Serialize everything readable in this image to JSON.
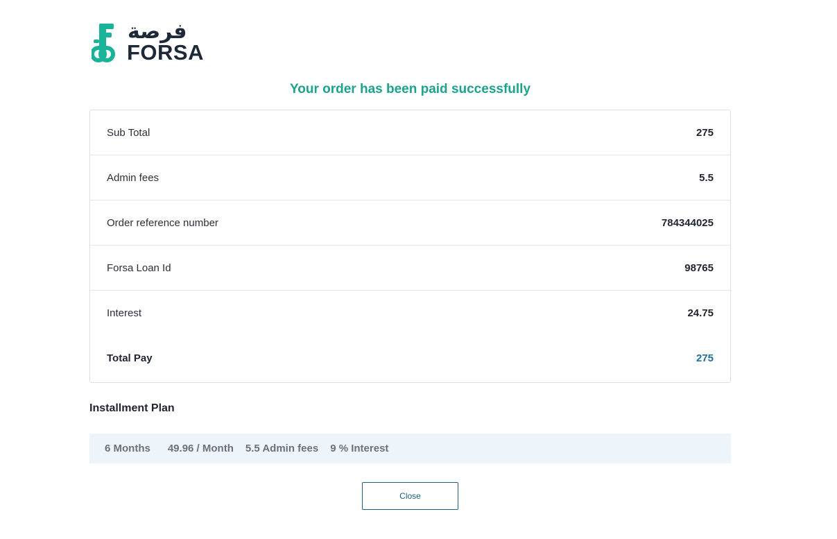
{
  "brand": {
    "arabic_name": "فرصة",
    "name": "FORSA",
    "logo_icon": "key-icon",
    "accent_color": "#19b39a",
    "text_color": "#1d2838"
  },
  "status": {
    "message": "Your order has been paid successfully",
    "color": "#1ba38c"
  },
  "summary": {
    "rows": [
      {
        "label": "Sub Total",
        "value": "275"
      },
      {
        "label": "Admin fees",
        "value": "5.5"
      },
      {
        "label": "Order reference number",
        "value": "784344025"
      },
      {
        "label": "Forsa Loan Id",
        "value": "98765"
      },
      {
        "label": "Interest",
        "value": "24.75"
      }
    ],
    "total": {
      "label": "Total Pay",
      "value": "275",
      "value_color": "#1d6f9e"
    }
  },
  "installment_plan": {
    "title": "Installment Plan",
    "months": "6 Months",
    "monthly": "49.96 / Month",
    "admin_fees": "5.5 Admin fees",
    "interest": "9 % Interest"
  },
  "actions": {
    "close_label": "Close"
  }
}
